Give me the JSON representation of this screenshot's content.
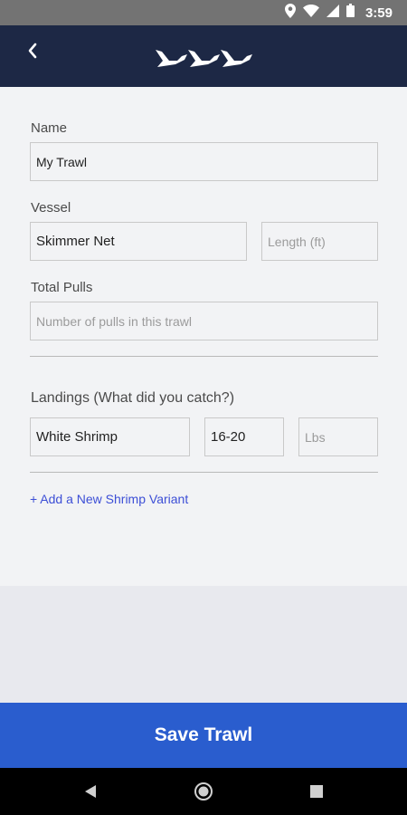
{
  "status_bar": {
    "time": "3:59",
    "icons": [
      "location-icon",
      "wifi-icon",
      "signal-icon",
      "battery-icon"
    ]
  },
  "app_bar": {
    "back_icon": "back-chevron-icon",
    "logo": "flying-birds-logo",
    "background_color": "#1d2845"
  },
  "form": {
    "name": {
      "label": "Name",
      "value": "My Trawl"
    },
    "vessel": {
      "label": "Vessel",
      "value": "Skimmer Net",
      "length_placeholder": "Length (ft)"
    },
    "total_pulls": {
      "label": "Total Pulls",
      "placeholder": "Number of pulls in this trawl"
    },
    "landings": {
      "label": "Landings (What did you catch?)",
      "species": "White Shrimp",
      "count": "16-20",
      "weight_placeholder": "Lbs"
    },
    "add_variant_label": "+ Add a New Shrimp Variant"
  },
  "save_button": {
    "label": "Save Trawl",
    "color": "#2a5dce"
  },
  "nav_bar": {
    "icons": [
      "back-triangle-icon",
      "home-circle-icon",
      "recents-square-icon"
    ]
  }
}
